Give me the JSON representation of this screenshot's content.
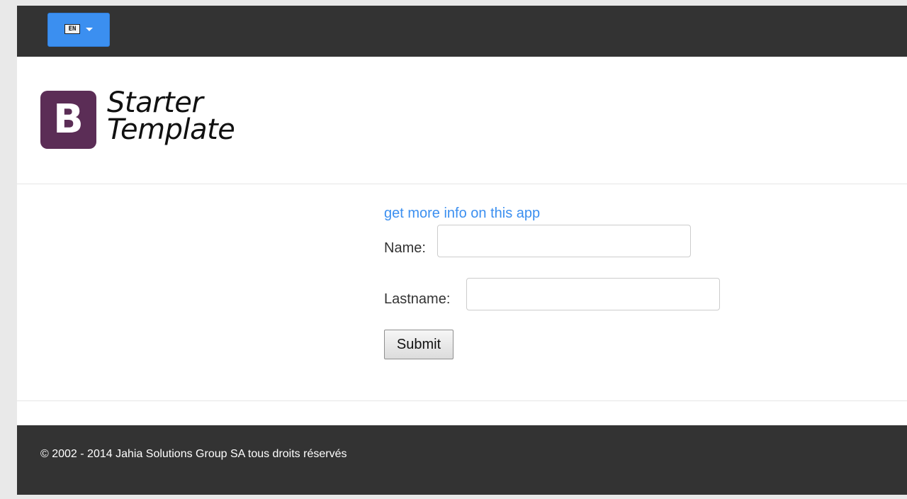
{
  "topbar": {
    "language_label": "EN",
    "language_icon": "flag-icon",
    "dropdown_icon": "caret-down-icon",
    "background_color": "#333333",
    "button_color": "#3b8ff0"
  },
  "header": {
    "logo_letter": "B",
    "logo_line1": "Starter",
    "logo_line2": "Template",
    "logo_color": "#5b2d56"
  },
  "main": {
    "info_link": "get more info on this app",
    "name_label": "Name:",
    "name_value": "",
    "lastname_label": "Lastname:",
    "lastname_value": "",
    "submit_label": "Submit",
    "link_color": "#3b8ff0"
  },
  "footer": {
    "copyright": "© 2002 - 2014 Jahia Solutions Group SA tous droits réservés",
    "background_color": "#333333"
  }
}
